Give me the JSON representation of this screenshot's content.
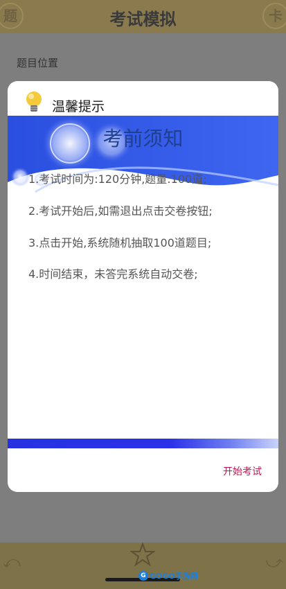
{
  "header": {
    "title": "考试模拟",
    "left_icon_glyph": "题",
    "right_icon_glyph": "卡"
  },
  "body": {
    "question_position_label": "题目位置"
  },
  "dialog": {
    "title": "温馨提示",
    "notice_heading": "考前须知",
    "rules": [
      "1.考试时间为:120分钟,题量:100道;",
      "2.考试开始后,如需退出点击交卷按钮;",
      "3.点击开始,系统随机抽取100道题目;",
      "4.时间结束，未答完系统自动交卷;"
    ],
    "start_button_label": "开始考试"
  },
  "watermark": {
    "text": "GOGO手游网"
  },
  "colors": {
    "header_bg": "#8a7a4e",
    "accent_red": "#c0174f",
    "banner_blue": "#1f3f8f"
  },
  "icons": [
    "lightbulb-icon",
    "star-icon",
    "back-arrow-icon",
    "forward-arrow-icon"
  ]
}
